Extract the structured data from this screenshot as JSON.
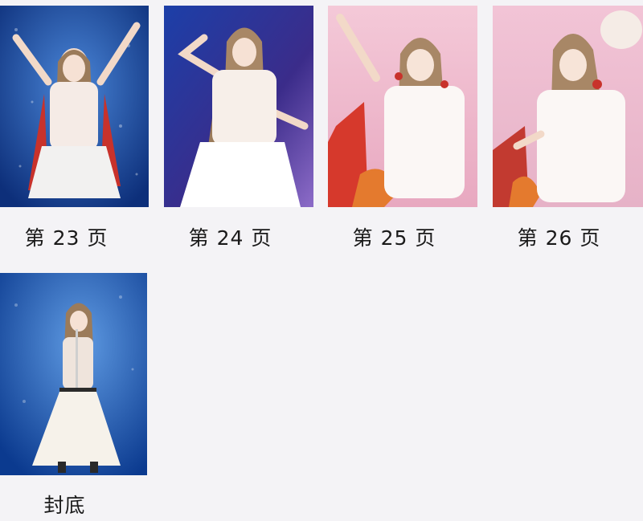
{
  "pages": [
    {
      "label": "第 23 页",
      "image": "performer-arms-raised-blue-stage"
    },
    {
      "label": "第 24 页",
      "image": "performer-dancing-purple-stage"
    },
    {
      "label": "第 25 页",
      "image": "performer-waving-pink-stage"
    },
    {
      "label": "第 26 页",
      "image": "performer-smiling-pink-stage"
    },
    {
      "label": "封底",
      "image": "performer-singing-microphone-blue-stage"
    }
  ],
  "colors": {
    "background": "#f4f3f6",
    "text": "#1a1a1a"
  }
}
